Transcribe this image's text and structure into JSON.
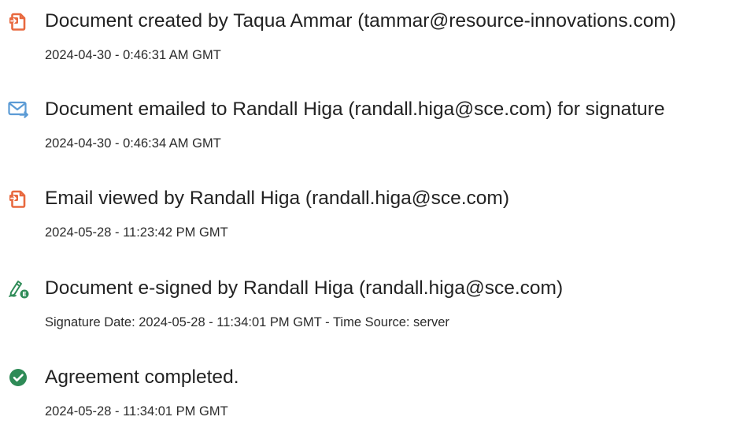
{
  "history": {
    "entries": [
      {
        "icon": "document-created-icon",
        "title": "Document created by Taqua Ammar (tammar@resource-innovations.com)",
        "subtitle": "2024-04-30 - 0:46:31 AM GMT"
      },
      {
        "icon": "email-sent-icon",
        "title": "Document emailed to Randall Higa (randall.higa@sce.com) for signature",
        "subtitle": "2024-04-30 - 0:46:34 AM GMT"
      },
      {
        "icon": "email-viewed-icon",
        "title": "Email viewed by Randall Higa (randall.higa@sce.com)",
        "subtitle": "2024-05-28 - 11:23:42 PM GMT"
      },
      {
        "icon": "e-signature-icon",
        "title": "Document e-signed by Randall Higa (randall.higa@sce.com)",
        "subtitle": "Signature Date: 2024-05-28 - 11:34:01 PM GMT - Time Source: server"
      },
      {
        "icon": "agreement-completed-icon",
        "title": "Agreement completed.",
        "subtitle": "2024-05-28 - 11:34:01 PM GMT"
      }
    ]
  },
  "colors": {
    "document_icon": "#e8693f",
    "email_icon": "#5b9bd5",
    "signature_icon": "#2e8b57",
    "completed_icon": "#2e8b57",
    "text": "#222222"
  }
}
